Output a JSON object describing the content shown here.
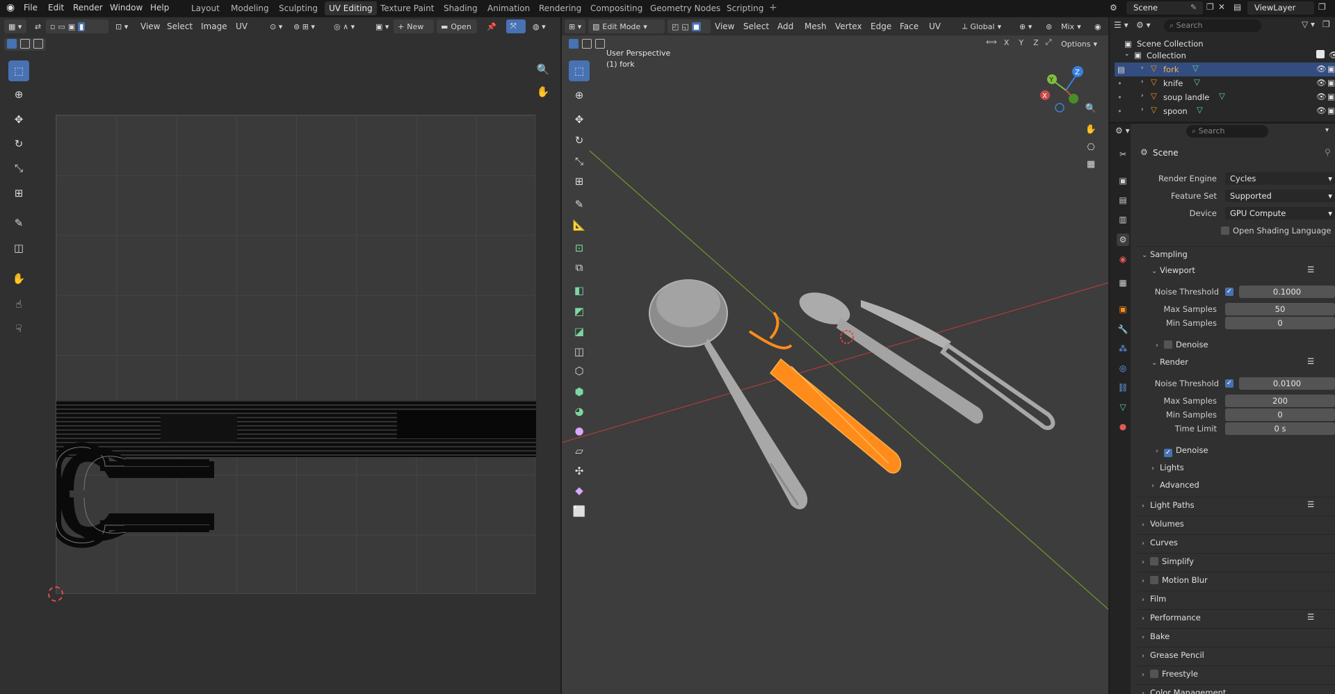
{
  "topbar": {
    "menus": [
      "File",
      "Edit",
      "Render",
      "Window",
      "Help"
    ],
    "workspaces": [
      "Layout",
      "Modeling",
      "Sculpting",
      "UV Editing",
      "Texture Paint",
      "Shading",
      "Animation",
      "Rendering",
      "Compositing",
      "Geometry Nodes",
      "Scripting"
    ],
    "active_workspace": "UV Editing",
    "scene_name": "Scene",
    "view_layer": "ViewLayer",
    "search_placeholder": "Search"
  },
  "uv_editor": {
    "menus": [
      "View",
      "Select",
      "Image",
      "UV"
    ],
    "new_label": "New",
    "open_label": "Open"
  },
  "viewport": {
    "mode": "Edit Mode",
    "menus": [
      "View",
      "Select",
      "Add",
      "Mesh",
      "Vertex",
      "Edge",
      "Face",
      "UV"
    ],
    "transform_orientation": "Global",
    "mix_label": "Mix",
    "options_label": "Options",
    "overlay_title": "User Perspective",
    "overlay_object": "(1) fork",
    "axis_x": "X",
    "axis_y": "Y",
    "axis_z": "Z",
    "gizmo_x": "X",
    "gizmo_y": "Y",
    "gizmo_z": "Z"
  },
  "outliner": {
    "search_placeholder": "Search",
    "scene_collection": "Scene Collection",
    "collection": "Collection",
    "objects": [
      "fork",
      "knife",
      "soup landle",
      "spoon"
    ],
    "selected": "fork"
  },
  "properties": {
    "search_placeholder": "Search",
    "context": "Scene",
    "render_engine_label": "Render Engine",
    "render_engine": "Cycles",
    "feature_set_label": "Feature Set",
    "feature_set": "Supported",
    "device_label": "Device",
    "device": "GPU Compute",
    "osl_label": "Open Shading Language",
    "sampling": "Sampling",
    "viewport_label": "Viewport",
    "noise_threshold_label": "Noise Threshold",
    "viewport_noise_threshold": "0.1000",
    "max_samples_label": "Max Samples",
    "viewport_max_samples": "50",
    "min_samples_label": "Min Samples",
    "viewport_min_samples": "0",
    "denoise_label": "Denoise",
    "render_label": "Render",
    "render_noise_threshold": "0.0100",
    "render_max_samples": "200",
    "render_min_samples": "0",
    "time_limit_label": "Time Limit",
    "time_limit": "0 s",
    "lights_label": "Lights",
    "advanced_label": "Advanced",
    "panels": [
      "Light Paths",
      "Volumes",
      "Curves",
      "Simplify",
      "Motion Blur",
      "Film",
      "Performance",
      "Bake",
      "Grease Pencil",
      "Freestyle",
      "Color Management"
    ]
  },
  "colors": {
    "accent": "#4772b3",
    "selection_orange": "#ff8c1a",
    "axis_red": "#b23a3a",
    "axis_green": "#6f9a2a"
  }
}
